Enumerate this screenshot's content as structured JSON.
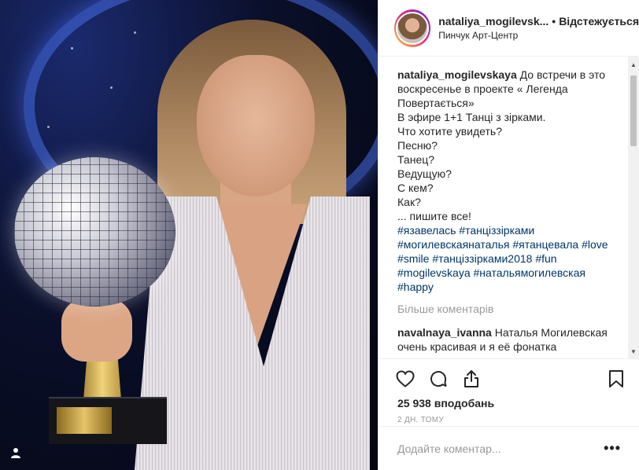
{
  "post": {
    "username": "nataliya_mogilevsk...",
    "follow_label": "Відстежується",
    "location": "Пинчук Арт-Центр"
  },
  "caption": {
    "username": "nataliya_mogilevskaya",
    "lines": [
      "До встречи в это воскресенье в проекте « Легенда Повертається»",
      "В эфире 1+1 Танці з зірками.",
      "Что хотите увидеть?",
      "Песню?",
      "Танец?",
      "Ведущую?",
      "С кем?",
      "Как?",
      "... пишите все!"
    ],
    "hashtags": [
      [
        "#язавелась",
        "#танціззірками"
      ],
      [
        "#могилевскаянаталья",
        "#ятанцевала",
        "#love"
      ],
      [
        "#smile",
        "#танціззірками2018",
        "#fun"
      ],
      [
        "#mogilevskaya",
        "#натальямогилевская"
      ],
      [
        "#happy"
      ]
    ]
  },
  "more_comments_label": "Більше коментарів",
  "comments": [
    {
      "username": "navalnaya_ivanna",
      "text": "Наталья Могилевская очень красивая и я её фонатка"
    }
  ],
  "likes_text": "25 938 вподобань",
  "time_text": "2 дн. тому",
  "add_comment_placeholder": "Додайте коментар...",
  "more_options": "•••",
  "icons": {
    "like": "heart-icon",
    "comment": "comment-icon",
    "share": "share-icon",
    "save": "bookmark-icon",
    "user_tag": "user-tag-icon"
  },
  "colors": {
    "hashtag": "#003569",
    "muted": "#999999",
    "text": "#262626"
  }
}
